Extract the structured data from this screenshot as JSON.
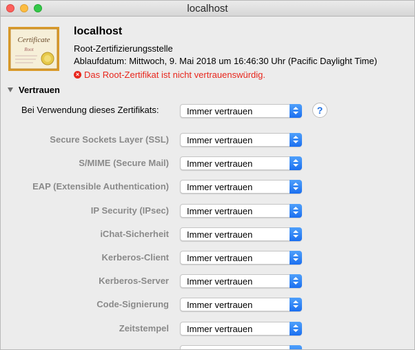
{
  "window": {
    "title": "localhost"
  },
  "certificate": {
    "icon_text_top": "Certificate",
    "icon_text_bottom": "Root",
    "name": "localhost",
    "kind": "Root-Zertifizierungsstelle",
    "expiry": "Ablaufdatum: Mittwoch, 9. Mai 2018 um 16:46:30 Uhr (Pacific Daylight Time)",
    "status": "Das Root-Zertifikat ist nicht vertrauenswürdig.",
    "status_color": "#e8261c"
  },
  "trust": {
    "section_label": "Vertrauen",
    "main_label": "Bei Verwendung dieses Zertifikats:",
    "main_value": "Immer vertrauen",
    "help_label": "?",
    "rows": [
      {
        "label": "Secure Sockets Layer (SSL)",
        "value": "Immer vertrauen"
      },
      {
        "label": "S/MIME (Secure Mail)",
        "value": "Immer vertrauen"
      },
      {
        "label": "EAP (Extensible Authentication)",
        "value": "Immer vertrauen"
      },
      {
        "label": "IP Security (IPsec)",
        "value": "Immer vertrauen"
      },
      {
        "label": "iChat-Sicherheit",
        "value": "Immer vertrauen"
      },
      {
        "label": "Kerberos-Client",
        "value": "Immer vertrauen"
      },
      {
        "label": "Kerberos-Server",
        "value": "Immer vertrauen"
      },
      {
        "label": "Code-Signierung",
        "value": "Immer vertrauen"
      },
      {
        "label": "Zeitstempel",
        "value": "Immer vertrauen"
      }
    ]
  },
  "colors": {
    "accent": "#1b6ff0"
  }
}
